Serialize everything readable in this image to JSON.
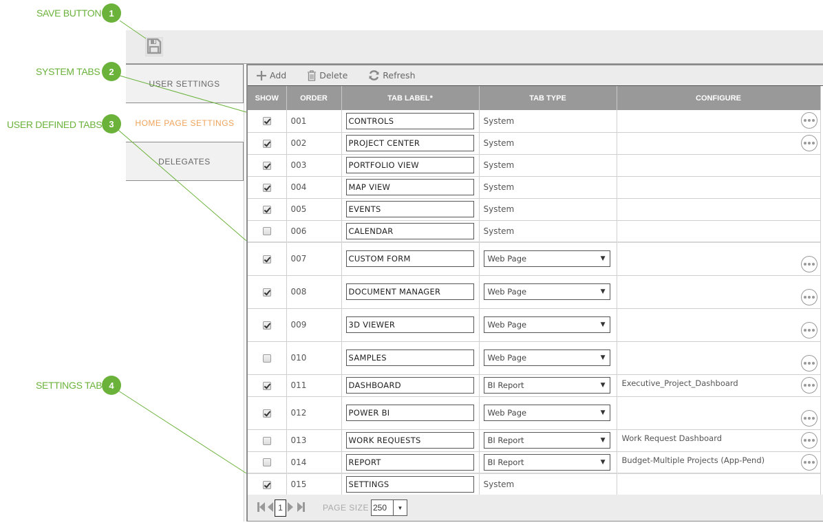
{
  "callouts": [
    {
      "number": "1",
      "label": "SAVE BUTTON"
    },
    {
      "number": "2",
      "label": "SYSTEM TABS"
    },
    {
      "number": "3",
      "label": "USER DEFINED TABS"
    },
    {
      "number": "4",
      "label": "SETTINGS TAB"
    }
  ],
  "toolbar": {
    "save_icon": "floppy-disk-icon"
  },
  "side_tabs": [
    {
      "label": "USER SETTINGS",
      "active": false
    },
    {
      "label": "HOME PAGE SETTINGS",
      "active": true
    },
    {
      "label": "DELEGATES",
      "active": false
    }
  ],
  "grid_toolbar": {
    "add": "Add",
    "delete": "Delete",
    "refresh": "Refresh"
  },
  "columns": [
    "SHOW",
    "ORDER",
    "TAB LABEL*",
    "TAB TYPE",
    "CONFIGURE"
  ],
  "rows": [
    {
      "show": true,
      "order": "001",
      "label": "CONTROLS",
      "type": "System",
      "editable_type": false,
      "configure": "",
      "has_config_button": true
    },
    {
      "show": true,
      "order": "002",
      "label": "PROJECT CENTER",
      "type": "System",
      "editable_type": false,
      "configure": "",
      "has_config_button": true
    },
    {
      "show": true,
      "order": "003",
      "label": "PORTFOLIO VIEW",
      "type": "System",
      "editable_type": false,
      "configure": "",
      "has_config_button": false
    },
    {
      "show": true,
      "order": "004",
      "label": "MAP VIEW",
      "type": "System",
      "editable_type": false,
      "configure": "",
      "has_config_button": false
    },
    {
      "show": true,
      "order": "005",
      "label": "EVENTS",
      "type": "System",
      "editable_type": false,
      "configure": "",
      "has_config_button": false
    },
    {
      "show": false,
      "order": "006",
      "label": "CALENDAR",
      "type": "System",
      "editable_type": false,
      "configure": "",
      "has_config_button": false
    },
    {
      "show": true,
      "order": "007",
      "label": "CUSTOM FORM",
      "type": "Web Page",
      "editable_type": true,
      "configure": "",
      "has_config_button": true
    },
    {
      "show": true,
      "order": "008",
      "label": "DOCUMENT MANAGER",
      "type": "Web Page",
      "editable_type": true,
      "configure": "",
      "has_config_button": true
    },
    {
      "show": true,
      "order": "009",
      "label": "3D VIEWER",
      "type": "Web Page",
      "editable_type": true,
      "configure": "",
      "has_config_button": true
    },
    {
      "show": false,
      "order": "010",
      "label": "SAMPLES",
      "type": "Web Page",
      "editable_type": true,
      "configure": "",
      "has_config_button": true
    },
    {
      "show": true,
      "order": "011",
      "label": "DASHBOARD",
      "type": "BI Report",
      "editable_type": true,
      "configure": "Executive_Project_Dashboard",
      "has_config_button": true
    },
    {
      "show": true,
      "order": "012",
      "label": "POWER BI",
      "type": "Web Page",
      "editable_type": true,
      "configure": "",
      "has_config_button": true
    },
    {
      "show": false,
      "order": "013",
      "label": "WORK REQUESTS",
      "type": "BI Report",
      "editable_type": true,
      "configure": "Work Request Dashboard",
      "has_config_button": true
    },
    {
      "show": false,
      "order": "014",
      "label": "REPORT",
      "type": "BI Report",
      "editable_type": true,
      "configure": "Budget-Multiple Projects (App-Pend)",
      "has_config_button": true
    },
    {
      "show": true,
      "order": "015",
      "label": "SETTINGS",
      "type": "System",
      "editable_type": false,
      "configure": "",
      "has_config_button": false
    }
  ],
  "pager": {
    "current_page": "1",
    "page_size_label": "PAGE SIZE",
    "page_size": "250"
  },
  "colors": {
    "accent_green": "#6ab23a",
    "active_tab": "#f0a35a",
    "header_gray": "#999999"
  }
}
